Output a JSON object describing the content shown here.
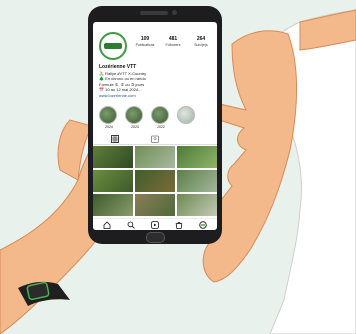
{
  "profile": {
    "stats": [
      {
        "value": "109",
        "label": "Publications"
      },
      {
        "value": "481",
        "label": "Followers"
      },
      {
        "value": "264",
        "label": "Suivi(e)s"
      }
    ],
    "name": "Lozérienne VTT",
    "bio_lines": [
      "🚴 Rallye #VTT X-Country",
      "🌲 En chrono ou en rando",
      "Formule ①, ② ou ③ jours",
      "📅 10 au 12 mai 2024..."
    ],
    "link": "www.lozerienne.com"
  },
  "highlights": [
    {
      "label": "2024"
    },
    {
      "label": "2023"
    },
    {
      "label": "2022"
    },
    {
      "label": ""
    }
  ],
  "tab_icons": [
    "grid-icon",
    "tagged-icon"
  ],
  "nav_icons": [
    "home-icon",
    "search-icon",
    "reels-icon",
    "shop-icon",
    "profile-icon"
  ],
  "colors": {
    "background": "#e9f1ec",
    "phone": "#1d1d1f",
    "skin": "#f4b98a",
    "watch": "#1f1f1f",
    "watch_accent": "#4caf50",
    "sleeve": "#ffffff",
    "brand_green": "#3e9a44"
  }
}
